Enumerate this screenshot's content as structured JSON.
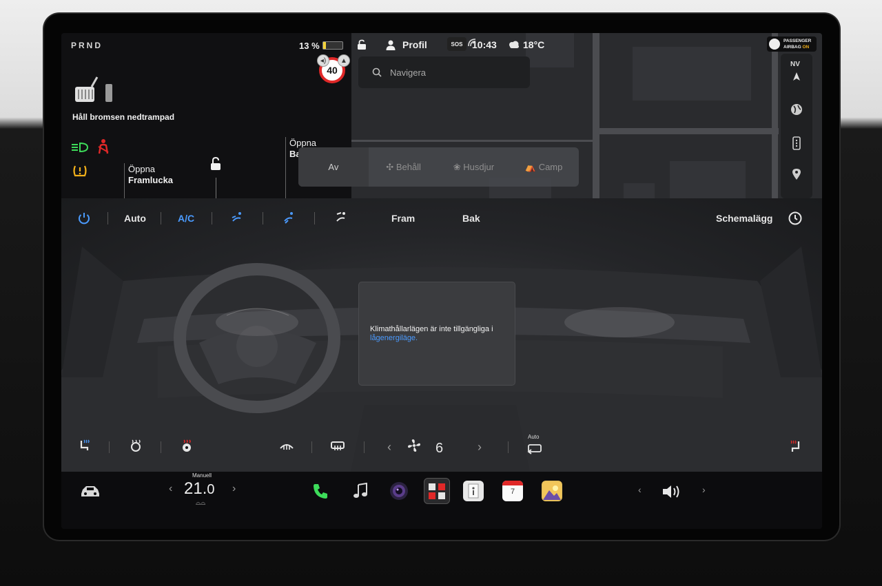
{
  "status": {
    "gear": "PRND",
    "battery_percent": "13 %",
    "battery_level": 0.13,
    "profile_label": "Profil",
    "sos_label": "SOS",
    "time": "10:43",
    "outside_temp": "18°C",
    "speed_limit": "40",
    "airbag_line1": "PASSENGER",
    "airbag_line2": "AIRBAG",
    "airbag_state": "ON"
  },
  "vehicle_panel": {
    "brake_message": "Håll bromsen nedtrampad",
    "frunk_line1": "Öppna",
    "frunk_line2": "Framlucka",
    "trunk_line1": "Öppna",
    "trunk_line2": "Ba"
  },
  "navigation": {
    "search_placeholder": "Navigera",
    "compass": "NV"
  },
  "climate_keeper": {
    "modes": [
      "Av",
      "Behåll",
      "Husdjur",
      "Camp"
    ]
  },
  "climate_bar": {
    "auto_label": "Auto",
    "ac_label": "A/C",
    "front_label": "Fram",
    "rear_label": "Bak",
    "schedule_label": "Schemalägg"
  },
  "notice": {
    "text": "Klimathållarlägen är inte tillgängliga i",
    "link": "lågenergiläge."
  },
  "fan": {
    "speed": "6",
    "recirc_label": "Auto"
  },
  "dock": {
    "temp_mode": "Manuell",
    "temp_int": "21.",
    "temp_dec": "0",
    "calendar_day": "7"
  },
  "colors": {
    "accent_blue": "#4b9bff",
    "warning_red": "#e02828",
    "indicator_green": "#3ddc5a",
    "warning_amber": "#f3b11a",
    "battery_yellow": "#f3d23a"
  }
}
